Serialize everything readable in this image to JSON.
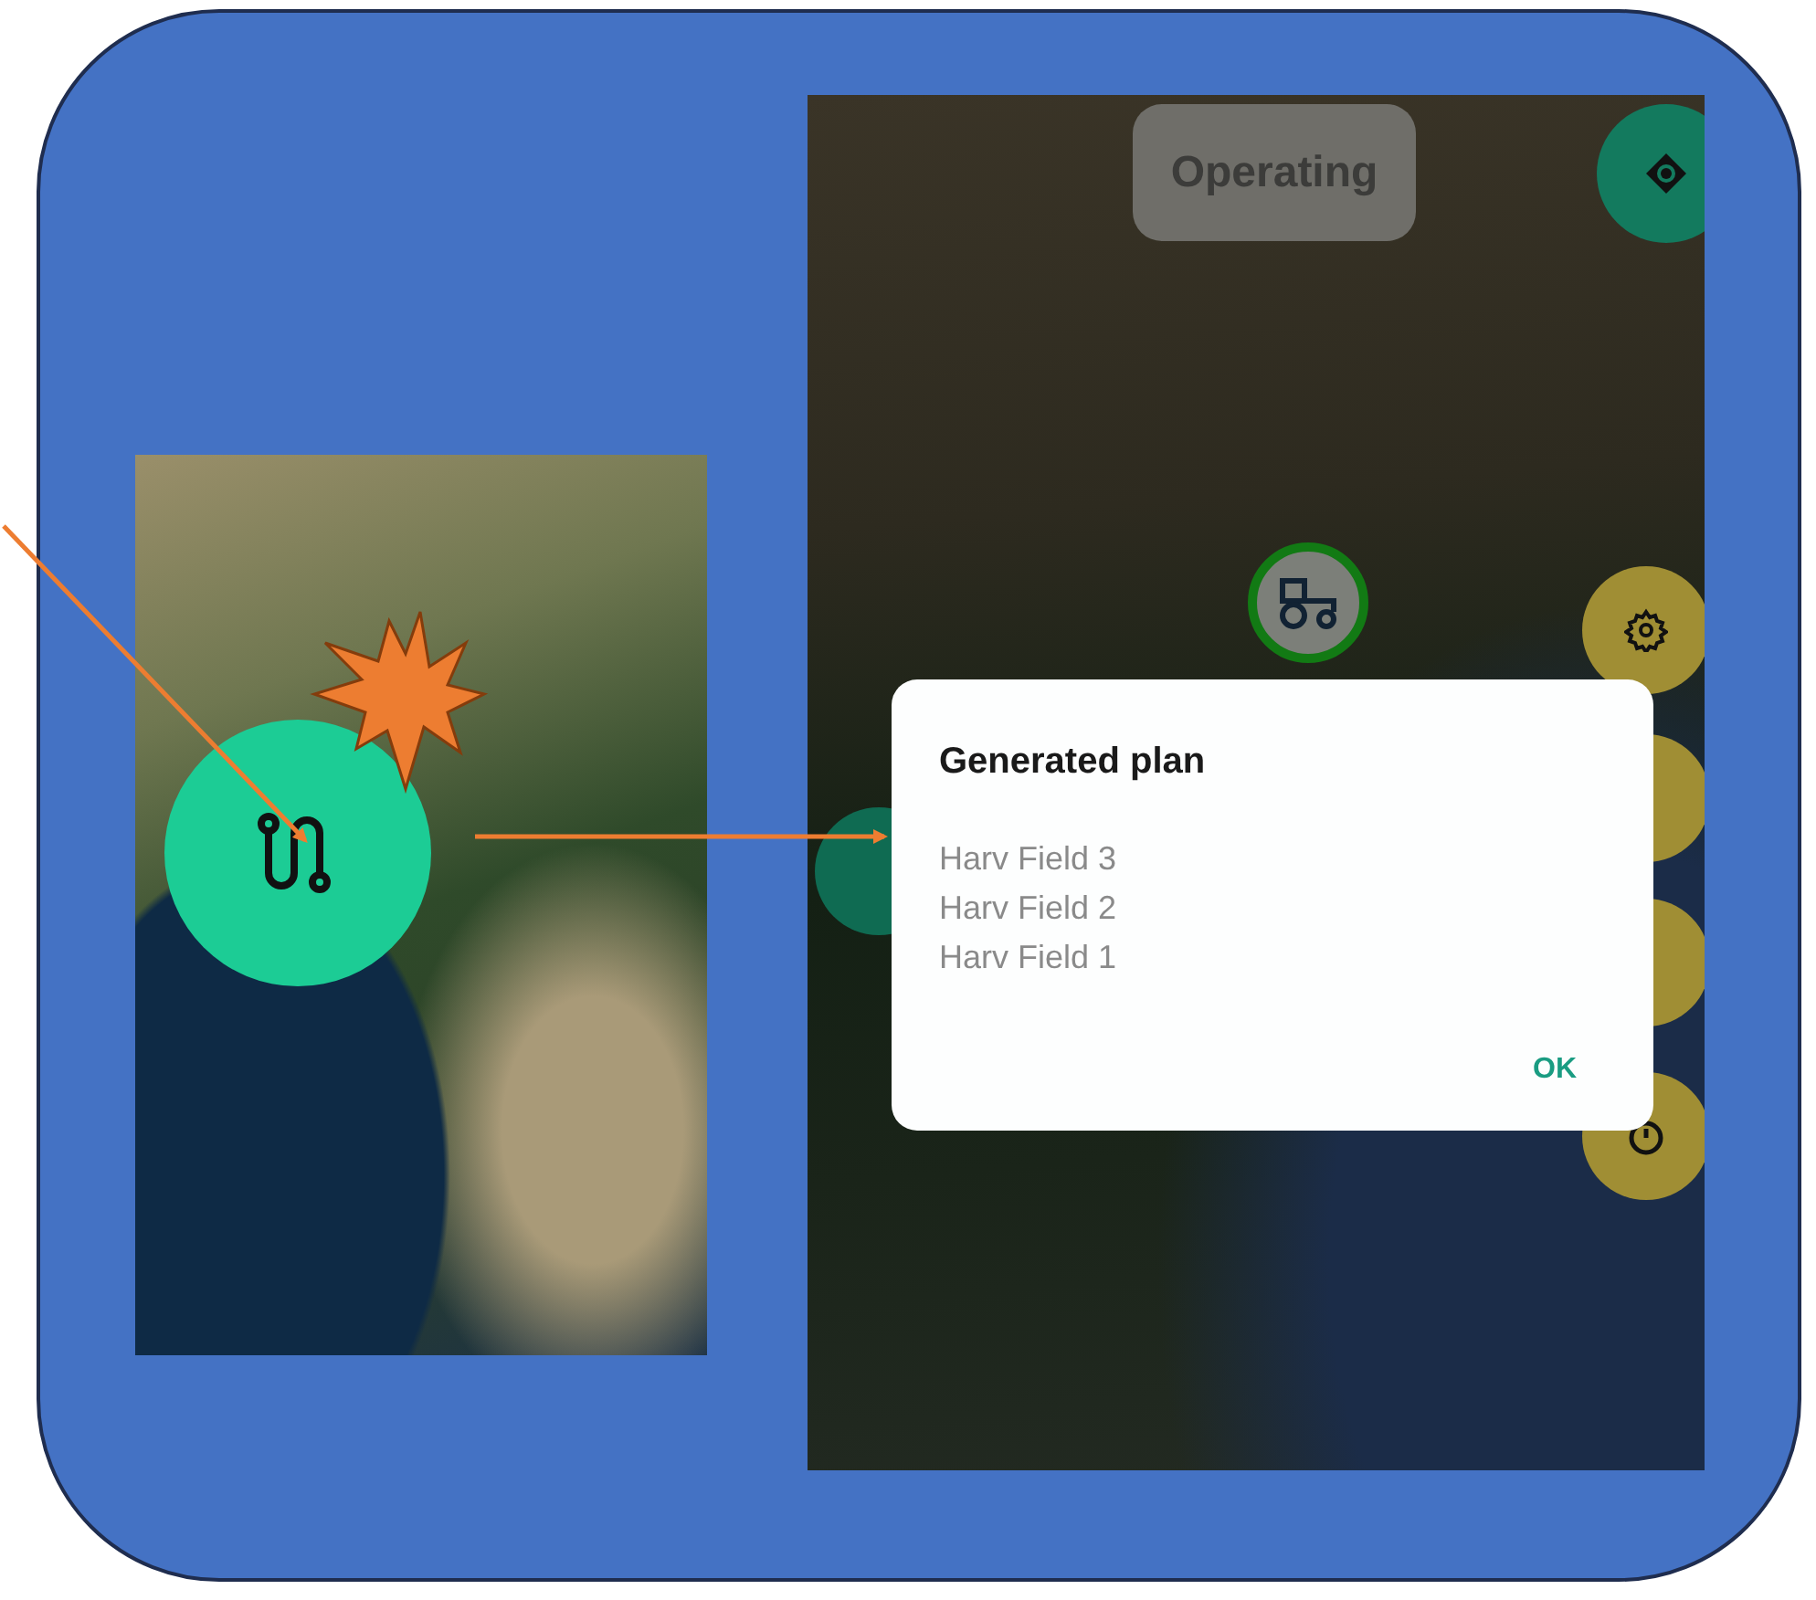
{
  "right_screen": {
    "status_chip": "Operating",
    "dialog": {
      "title": "Generated plan",
      "items": [
        "Harv Field 3",
        "Harv Field 2",
        "Harv Field 1"
      ],
      "button": "OK"
    }
  }
}
